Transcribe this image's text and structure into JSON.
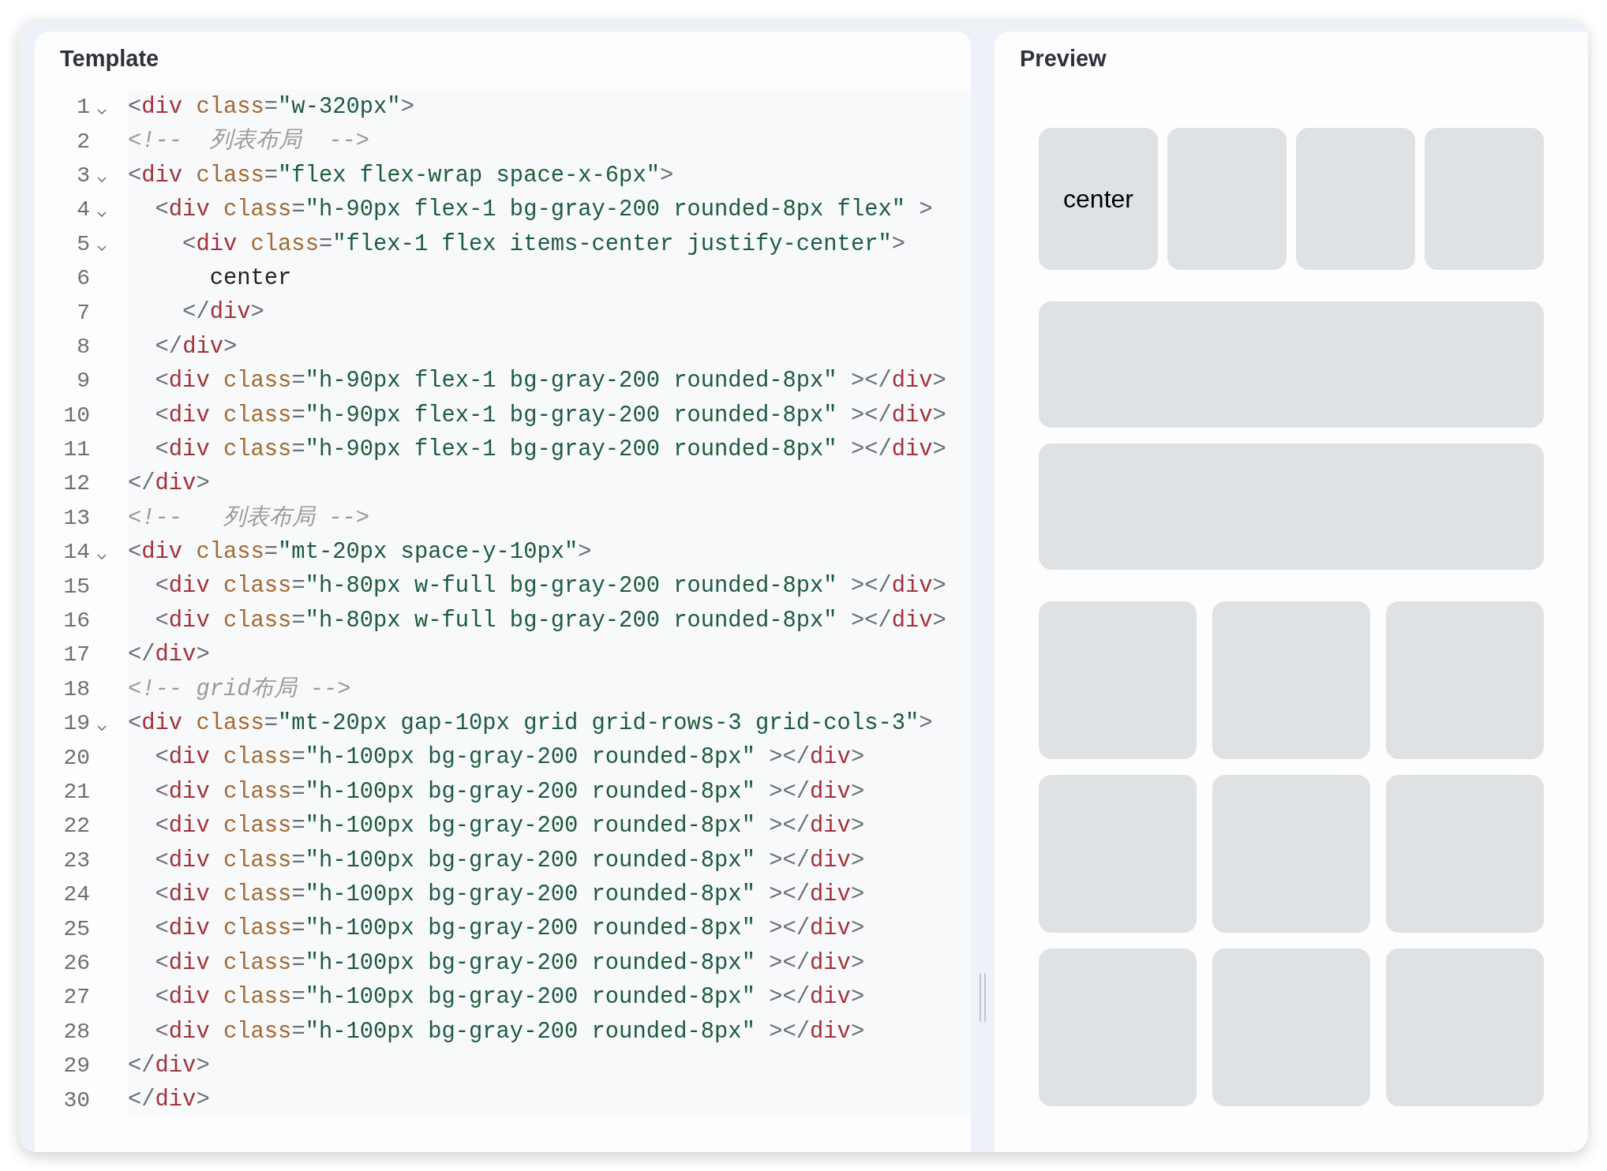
{
  "template": {
    "title": "Template",
    "lines": [
      {
        "number": "1",
        "foldable": true,
        "tokens": [
          {
            "kind": "punct",
            "text": "<"
          },
          {
            "kind": "tag",
            "text": "div"
          },
          {
            "kind": "attr",
            "text": " class"
          },
          {
            "kind": "punct",
            "text": "="
          },
          {
            "kind": "string",
            "text": "\"w-320px\""
          },
          {
            "kind": "punct",
            "text": ">"
          }
        ]
      },
      {
        "number": "2",
        "foldable": false,
        "tokens": [
          {
            "kind": "comment",
            "text": "<!--  列表布局  -->"
          }
        ]
      },
      {
        "number": "3",
        "foldable": true,
        "tokens": [
          {
            "kind": "punct",
            "text": "<"
          },
          {
            "kind": "tag",
            "text": "div"
          },
          {
            "kind": "attr",
            "text": " class"
          },
          {
            "kind": "punct",
            "text": "="
          },
          {
            "kind": "string",
            "text": "\"flex flex-wrap space-x-6px\""
          },
          {
            "kind": "punct",
            "text": ">"
          }
        ]
      },
      {
        "number": "4",
        "foldable": true,
        "tokens": [
          {
            "kind": "punct",
            "text": "  <"
          },
          {
            "kind": "tag",
            "text": "div"
          },
          {
            "kind": "attr",
            "text": " class"
          },
          {
            "kind": "punct",
            "text": "="
          },
          {
            "kind": "string",
            "text": "\"h-90px flex-1 bg-gray-200 rounded-8px flex\""
          },
          {
            "kind": "punct",
            "text": " >"
          }
        ]
      },
      {
        "number": "5",
        "foldable": true,
        "tokens": [
          {
            "kind": "punct",
            "text": "    <"
          },
          {
            "kind": "tag",
            "text": "div"
          },
          {
            "kind": "attr",
            "text": " class"
          },
          {
            "kind": "punct",
            "text": "="
          },
          {
            "kind": "string",
            "text": "\"flex-1 flex items-center justify-center\""
          },
          {
            "kind": "punct",
            "text": ">"
          }
        ]
      },
      {
        "number": "6",
        "foldable": false,
        "tokens": [
          {
            "kind": "text",
            "text": "      center"
          }
        ]
      },
      {
        "number": "7",
        "foldable": false,
        "tokens": [
          {
            "kind": "punct",
            "text": "    </"
          },
          {
            "kind": "tag",
            "text": "div"
          },
          {
            "kind": "punct",
            "text": ">"
          }
        ]
      },
      {
        "number": "8",
        "foldable": false,
        "tokens": [
          {
            "kind": "punct",
            "text": "  </"
          },
          {
            "kind": "tag",
            "text": "div"
          },
          {
            "kind": "punct",
            "text": ">"
          }
        ]
      },
      {
        "number": "9",
        "foldable": false,
        "tokens": [
          {
            "kind": "punct",
            "text": "  <"
          },
          {
            "kind": "tag",
            "text": "div"
          },
          {
            "kind": "attr",
            "text": " class"
          },
          {
            "kind": "punct",
            "text": "="
          },
          {
            "kind": "string",
            "text": "\"h-90px flex-1 bg-gray-200 rounded-8px\""
          },
          {
            "kind": "punct",
            "text": " ></"
          },
          {
            "kind": "tag",
            "text": "div"
          },
          {
            "kind": "punct",
            "text": ">"
          }
        ]
      },
      {
        "number": "10",
        "foldable": false,
        "tokens": [
          {
            "kind": "punct",
            "text": "  <"
          },
          {
            "kind": "tag",
            "text": "div"
          },
          {
            "kind": "attr",
            "text": " class"
          },
          {
            "kind": "punct",
            "text": "="
          },
          {
            "kind": "string",
            "text": "\"h-90px flex-1 bg-gray-200 rounded-8px\""
          },
          {
            "kind": "punct",
            "text": " ></"
          },
          {
            "kind": "tag",
            "text": "div"
          },
          {
            "kind": "punct",
            "text": ">"
          }
        ]
      },
      {
        "number": "11",
        "foldable": false,
        "tokens": [
          {
            "kind": "punct",
            "text": "  <"
          },
          {
            "kind": "tag",
            "text": "div"
          },
          {
            "kind": "attr",
            "text": " class"
          },
          {
            "kind": "punct",
            "text": "="
          },
          {
            "kind": "string",
            "text": "\"h-90px flex-1 bg-gray-200 rounded-8px\""
          },
          {
            "kind": "punct",
            "text": " ></"
          },
          {
            "kind": "tag",
            "text": "div"
          },
          {
            "kind": "punct",
            "text": ">"
          }
        ]
      },
      {
        "number": "12",
        "foldable": false,
        "tokens": [
          {
            "kind": "punct",
            "text": "</"
          },
          {
            "kind": "tag",
            "text": "div"
          },
          {
            "kind": "punct",
            "text": ">"
          }
        ]
      },
      {
        "number": "13",
        "foldable": false,
        "tokens": [
          {
            "kind": "comment",
            "text": "<!--   列表布局 -->"
          }
        ]
      },
      {
        "number": "14",
        "foldable": true,
        "tokens": [
          {
            "kind": "punct",
            "text": "<"
          },
          {
            "kind": "tag",
            "text": "div"
          },
          {
            "kind": "attr",
            "text": " class"
          },
          {
            "kind": "punct",
            "text": "="
          },
          {
            "kind": "string",
            "text": "\"mt-20px space-y-10px\""
          },
          {
            "kind": "punct",
            "text": ">"
          }
        ]
      },
      {
        "number": "15",
        "foldable": false,
        "tokens": [
          {
            "kind": "punct",
            "text": "  <"
          },
          {
            "kind": "tag",
            "text": "div"
          },
          {
            "kind": "attr",
            "text": " class"
          },
          {
            "kind": "punct",
            "text": "="
          },
          {
            "kind": "string",
            "text": "\"h-80px w-full bg-gray-200 rounded-8px\""
          },
          {
            "kind": "punct",
            "text": " ></"
          },
          {
            "kind": "tag",
            "text": "div"
          },
          {
            "kind": "punct",
            "text": ">"
          }
        ]
      },
      {
        "number": "16",
        "foldable": false,
        "tokens": [
          {
            "kind": "punct",
            "text": "  <"
          },
          {
            "kind": "tag",
            "text": "div"
          },
          {
            "kind": "attr",
            "text": " class"
          },
          {
            "kind": "punct",
            "text": "="
          },
          {
            "kind": "string",
            "text": "\"h-80px w-full bg-gray-200 rounded-8px\""
          },
          {
            "kind": "punct",
            "text": " ></"
          },
          {
            "kind": "tag",
            "text": "div"
          },
          {
            "kind": "punct",
            "text": ">"
          }
        ]
      },
      {
        "number": "17",
        "foldable": false,
        "tokens": [
          {
            "kind": "punct",
            "text": "</"
          },
          {
            "kind": "tag",
            "text": "div"
          },
          {
            "kind": "punct",
            "text": ">"
          }
        ]
      },
      {
        "number": "18",
        "foldable": false,
        "tokens": [
          {
            "kind": "comment",
            "text": "<!-- grid布局 -->"
          }
        ]
      },
      {
        "number": "19",
        "foldable": true,
        "tokens": [
          {
            "kind": "punct",
            "text": "<"
          },
          {
            "kind": "tag",
            "text": "div"
          },
          {
            "kind": "attr",
            "text": " class"
          },
          {
            "kind": "punct",
            "text": "="
          },
          {
            "kind": "string",
            "text": "\"mt-20px gap-10px grid grid-rows-3 grid-cols-3\""
          },
          {
            "kind": "punct",
            "text": ">"
          }
        ]
      },
      {
        "number": "20",
        "foldable": false,
        "tokens": [
          {
            "kind": "punct",
            "text": "  <"
          },
          {
            "kind": "tag",
            "text": "div"
          },
          {
            "kind": "attr",
            "text": " class"
          },
          {
            "kind": "punct",
            "text": "="
          },
          {
            "kind": "string",
            "text": "\"h-100px bg-gray-200 rounded-8px\""
          },
          {
            "kind": "punct",
            "text": " ></"
          },
          {
            "kind": "tag",
            "text": "div"
          },
          {
            "kind": "punct",
            "text": ">"
          }
        ]
      },
      {
        "number": "21",
        "foldable": false,
        "tokens": [
          {
            "kind": "punct",
            "text": "  <"
          },
          {
            "kind": "tag",
            "text": "div"
          },
          {
            "kind": "attr",
            "text": " class"
          },
          {
            "kind": "punct",
            "text": "="
          },
          {
            "kind": "string",
            "text": "\"h-100px bg-gray-200 rounded-8px\""
          },
          {
            "kind": "punct",
            "text": " ></"
          },
          {
            "kind": "tag",
            "text": "div"
          },
          {
            "kind": "punct",
            "text": ">"
          }
        ]
      },
      {
        "number": "22",
        "foldable": false,
        "tokens": [
          {
            "kind": "punct",
            "text": "  <"
          },
          {
            "kind": "tag",
            "text": "div"
          },
          {
            "kind": "attr",
            "text": " class"
          },
          {
            "kind": "punct",
            "text": "="
          },
          {
            "kind": "string",
            "text": "\"h-100px bg-gray-200 rounded-8px\""
          },
          {
            "kind": "punct",
            "text": " ></"
          },
          {
            "kind": "tag",
            "text": "div"
          },
          {
            "kind": "punct",
            "text": ">"
          }
        ]
      },
      {
        "number": "23",
        "foldable": false,
        "tokens": [
          {
            "kind": "punct",
            "text": "  <"
          },
          {
            "kind": "tag",
            "text": "div"
          },
          {
            "kind": "attr",
            "text": " class"
          },
          {
            "kind": "punct",
            "text": "="
          },
          {
            "kind": "string",
            "text": "\"h-100px bg-gray-200 rounded-8px\""
          },
          {
            "kind": "punct",
            "text": " ></"
          },
          {
            "kind": "tag",
            "text": "div"
          },
          {
            "kind": "punct",
            "text": ">"
          }
        ]
      },
      {
        "number": "24",
        "foldable": false,
        "tokens": [
          {
            "kind": "punct",
            "text": "  <"
          },
          {
            "kind": "tag",
            "text": "div"
          },
          {
            "kind": "attr",
            "text": " class"
          },
          {
            "kind": "punct",
            "text": "="
          },
          {
            "kind": "string",
            "text": "\"h-100px bg-gray-200 rounded-8px\""
          },
          {
            "kind": "punct",
            "text": " ></"
          },
          {
            "kind": "tag",
            "text": "div"
          },
          {
            "kind": "punct",
            "text": ">"
          }
        ]
      },
      {
        "number": "25",
        "foldable": false,
        "tokens": [
          {
            "kind": "punct",
            "text": "  <"
          },
          {
            "kind": "tag",
            "text": "div"
          },
          {
            "kind": "attr",
            "text": " class"
          },
          {
            "kind": "punct",
            "text": "="
          },
          {
            "kind": "string",
            "text": "\"h-100px bg-gray-200 rounded-8px\""
          },
          {
            "kind": "punct",
            "text": " ></"
          },
          {
            "kind": "tag",
            "text": "div"
          },
          {
            "kind": "punct",
            "text": ">"
          }
        ]
      },
      {
        "number": "26",
        "foldable": false,
        "tokens": [
          {
            "kind": "punct",
            "text": "  <"
          },
          {
            "kind": "tag",
            "text": "div"
          },
          {
            "kind": "attr",
            "text": " class"
          },
          {
            "kind": "punct",
            "text": "="
          },
          {
            "kind": "string",
            "text": "\"h-100px bg-gray-200 rounded-8px\""
          },
          {
            "kind": "punct",
            "text": " ></"
          },
          {
            "kind": "tag",
            "text": "div"
          },
          {
            "kind": "punct",
            "text": ">"
          }
        ]
      },
      {
        "number": "27",
        "foldable": false,
        "tokens": [
          {
            "kind": "punct",
            "text": "  <"
          },
          {
            "kind": "tag",
            "text": "div"
          },
          {
            "kind": "attr",
            "text": " class"
          },
          {
            "kind": "punct",
            "text": "="
          },
          {
            "kind": "string",
            "text": "\"h-100px bg-gray-200 rounded-8px\""
          },
          {
            "kind": "punct",
            "text": " ></"
          },
          {
            "kind": "tag",
            "text": "div"
          },
          {
            "kind": "punct",
            "text": ">"
          }
        ]
      },
      {
        "number": "28",
        "foldable": false,
        "tokens": [
          {
            "kind": "punct",
            "text": "  <"
          },
          {
            "kind": "tag",
            "text": "div"
          },
          {
            "kind": "attr",
            "text": " class"
          },
          {
            "kind": "punct",
            "text": "="
          },
          {
            "kind": "string",
            "text": "\"h-100px bg-gray-200 rounded-8px\""
          },
          {
            "kind": "punct",
            "text": " ></"
          },
          {
            "kind": "tag",
            "text": "div"
          },
          {
            "kind": "punct",
            "text": ">"
          }
        ]
      },
      {
        "number": "29",
        "foldable": false,
        "tokens": [
          {
            "kind": "punct",
            "text": "</"
          },
          {
            "kind": "tag",
            "text": "div"
          },
          {
            "kind": "punct",
            "text": ">"
          }
        ]
      },
      {
        "number": "30",
        "foldable": false,
        "tokens": [
          {
            "kind": "punct",
            "text": "</"
          },
          {
            "kind": "tag",
            "text": "div"
          },
          {
            "kind": "punct",
            "text": ">"
          }
        ]
      }
    ]
  },
  "preview": {
    "title": "Preview",
    "flex_row": [
      {
        "kind": "labeled",
        "label": "center"
      },
      {
        "kind": "plain"
      },
      {
        "kind": "plain"
      },
      {
        "kind": "plain"
      }
    ],
    "stack": [
      {
        "kind": "plain"
      },
      {
        "kind": "plain"
      }
    ],
    "grid": [
      {
        "kind": "plain"
      },
      {
        "kind": "plain"
      },
      {
        "kind": "plain"
      },
      {
        "kind": "plain"
      },
      {
        "kind": "plain"
      },
      {
        "kind": "plain"
      },
      {
        "kind": "plain"
      },
      {
        "kind": "plain"
      },
      {
        "kind": "plain"
      }
    ]
  }
}
